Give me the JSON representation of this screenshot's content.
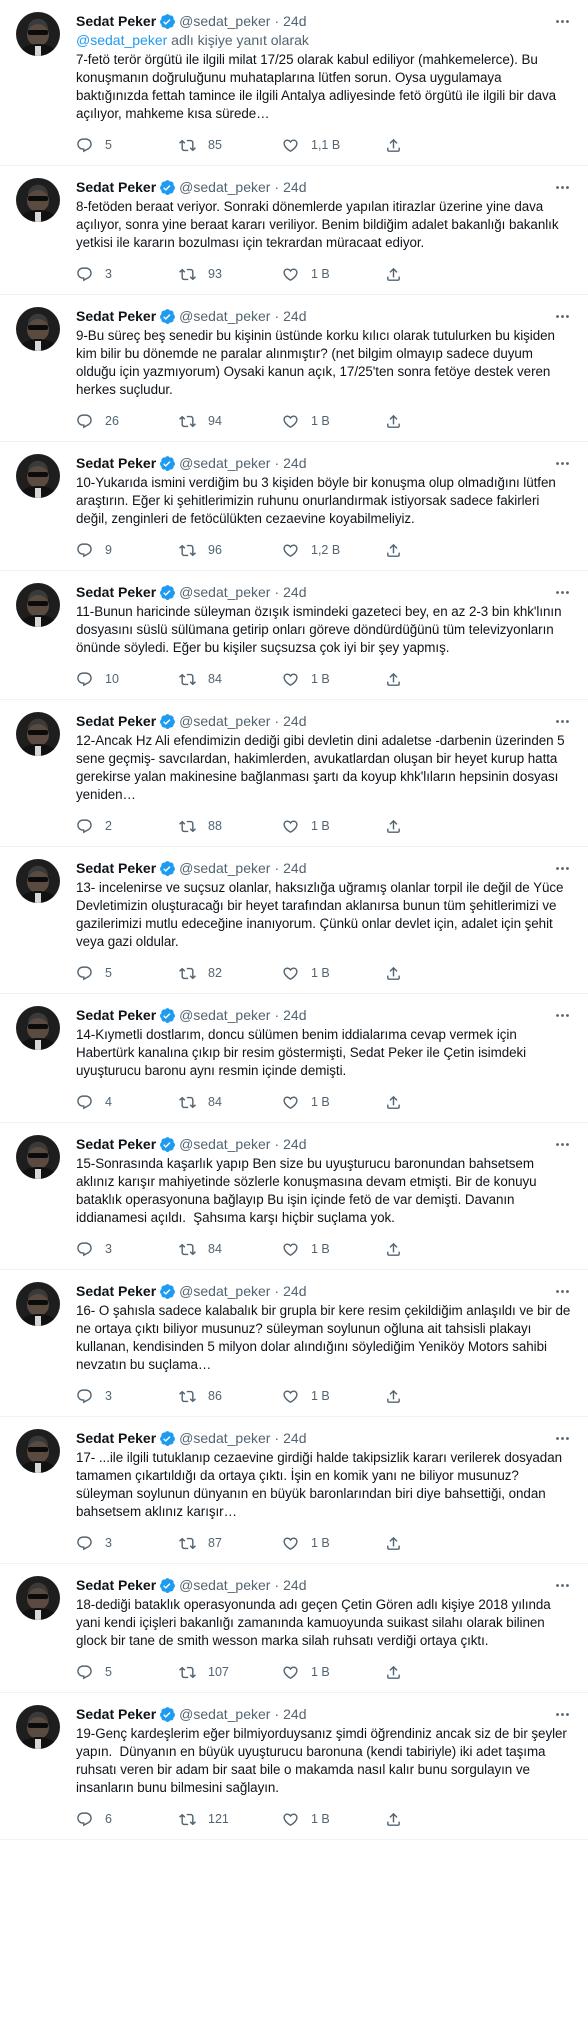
{
  "author": {
    "name": "Sedat Peker",
    "handle": "@sedat_peker",
    "date": "24d",
    "dot": "·"
  },
  "reply_prefix": "@sedat_peker",
  "reply_suffix": " adlı kişiye yanıt olarak",
  "tweets": [
    {
      "text": "7-fetö terör örgütü ile ilgili milat 17/25 olarak kabul ediliyor (mahkemelerce). Bu konuşmanın doğruluğunu muhataplarına lütfen sorun. Oysa uygulamaya baktığınızda fettah tamince ile ilgili Antalya adliyesinde fetö örgütü ile ilgili bir dava açılıyor, mahkeme kısa sürede…",
      "replies": "5",
      "retweets": "85",
      "likes": "1,1 B"
    },
    {
      "text": "8-fetöden beraat veriyor. Sonraki dönemlerde yapılan itirazlar üzerine yine dava açılıyor, sonra yine beraat kararı veriliyor. Benim bildiğim adalet bakanlığı bakanlık yetkisi ile kararın bozulması için tekrardan müracaat ediyor.",
      "replies": "3",
      "retweets": "93",
      "likes": "1 B"
    },
    {
      "text": "9-Bu süreç beş senedir bu kişinin üstünde korku kılıcı olarak tutulurken bu kişiden kim bilir bu dönemde ne paralar alınmıştır? (net bilgim olmayıp sadece duyum olduğu için yazmıyorum) Oysaki kanun açık, 17/25'ten sonra fetöye destek veren herkes suçludur.",
      "replies": "26",
      "retweets": "94",
      "likes": "1 B"
    },
    {
      "text": "10-Yukarıda ismini verdiğim bu 3 kişiden böyle bir konuşma olup olmadığını lütfen araştırın. Eğer ki şehitlerimizin ruhunu onurlandırmak istiyorsak sadece fakirleri değil, zenginleri de fetöcülükten cezaevine koyabilmeliyiz.",
      "replies": "9",
      "retweets": "96",
      "likes": "1,2 B"
    },
    {
      "text": "11-Bunun haricinde süleyman özışık ismindeki gazeteci bey, en az 2-3 bin khk'lının dosyasını süslü sülümana getirip onları göreve döndürdüğünü tüm televizyonların önünde söyledi. Eğer bu kişiler suçsuzsa çok iyi bir şey yapmış.",
      "replies": "10",
      "retweets": "84",
      "likes": "1 B"
    },
    {
      "text": "12-Ancak Hz Ali efendimizin dediği gibi devletin dini adaletse -darbenin üzerinden 5 sene geçmiş- savcılardan, hakimlerden, avukatlardan oluşan bir heyet kurup hatta gerekirse yalan makinesine bağlanması şartı da koyup khk'lıların hepsinin dosyası yeniden…",
      "replies": "2",
      "retweets": "88",
      "likes": "1 B"
    },
    {
      "text": "13- incelenirse ve suçsuz olanlar, haksızlığa uğramış olanlar torpil ile değil de Yüce Devletimizin oluşturacağı bir heyet tarafından aklanırsa bunun tüm şehitlerimizi ve gazilerimizi mutlu edeceğine inanıyorum. Çünkü onlar devlet için, adalet için şehit veya gazi oldular.",
      "replies": "5",
      "retweets": "82",
      "likes": "1 B"
    },
    {
      "text": "14-Kıymetli dostlarım, doncu sülümen benim iddialarıma cevap vermek için Habertürk kanalına çıkıp bir resim göstermişti, Sedat Peker ile Çetin isimdeki uyuşturucu baronu aynı resmin içinde demişti.",
      "replies": "4",
      "retweets": "84",
      "likes": "1 B"
    },
    {
      "text": "15-Sonrasında kaşarlık yapıp Ben size bu uyuşturucu baronundan bahsetsem aklınız karışır mahiyetinde sözlerle konuşmasına devam etmişti. Bir de konuyu bataklık operasyonuna bağlayıp Bu işin içinde fetö de var demişti. Davanın iddianamesi açıldı.  Şahsıma karşı hiçbir suçlama yok.",
      "replies": "3",
      "retweets": "84",
      "likes": "1 B"
    },
    {
      "text": "16- O şahısla sadece kalabalık bir grupla bir kere resim çekildiğim anlaşıldı ve bir de ne ortaya çıktı biliyor musunuz? süleyman soylunun oğluna ait tahsisli plakayı kullanan, kendisinden 5 milyon dolar alındığını söylediğim Yeniköy Motors sahibi nevzatın bu suçlama…",
      "replies": "3",
      "retweets": "86",
      "likes": "1 B"
    },
    {
      "text": "17- ...ile ilgili tutuklanıp cezaevine girdiği halde takipsizlik kararı verilerek dosyadan tamamen çıkartıldığı da ortaya çıktı. İşin en komik yanı ne biliyor musunuz? süleyman soylunun dünyanın en büyük baronlarından biri diye bahsettiği, ondan bahsetsem aklınız karışır…",
      "replies": "3",
      "retweets": "87",
      "likes": "1 B"
    },
    {
      "text": "18-dediği bataklık operasyonunda adı geçen Çetin Gören adlı kişiye 2018 yılında yani kendi içişleri bakanlığı zamanında kamuoyunda suikast silahı olarak bilinen glock bir tane de smith wesson marka silah ruhsatı verdiği ortaya çıktı.",
      "replies": "5",
      "retweets": "107",
      "likes": "1 B"
    },
    {
      "text": "19-Genç kardeşlerim eğer bilmiyorduysanız şimdi öğrendiniz ancak siz de bir şeyler yapın.  Dünyanın en büyük uyuşturucu baronuna (kendi tabiriyle) iki adet taşıma ruhsatı veren bir adam bir saat bile o makamda nasıl kalır bunu sorgulayın ve insanların bunu bilmesini sağlayın.",
      "replies": "6",
      "retweets": "121",
      "likes": "1 B"
    }
  ],
  "icons": {
    "verified": "verified-badge-icon",
    "more": "more-dots-icon",
    "reply": "reply-icon",
    "retweet": "retweet-icon",
    "like": "heart-icon",
    "share": "share-icon"
  },
  "colors": {
    "accent": "#1d9bf0",
    "secondary_text": "#536471",
    "divider": "#eff3f4"
  }
}
